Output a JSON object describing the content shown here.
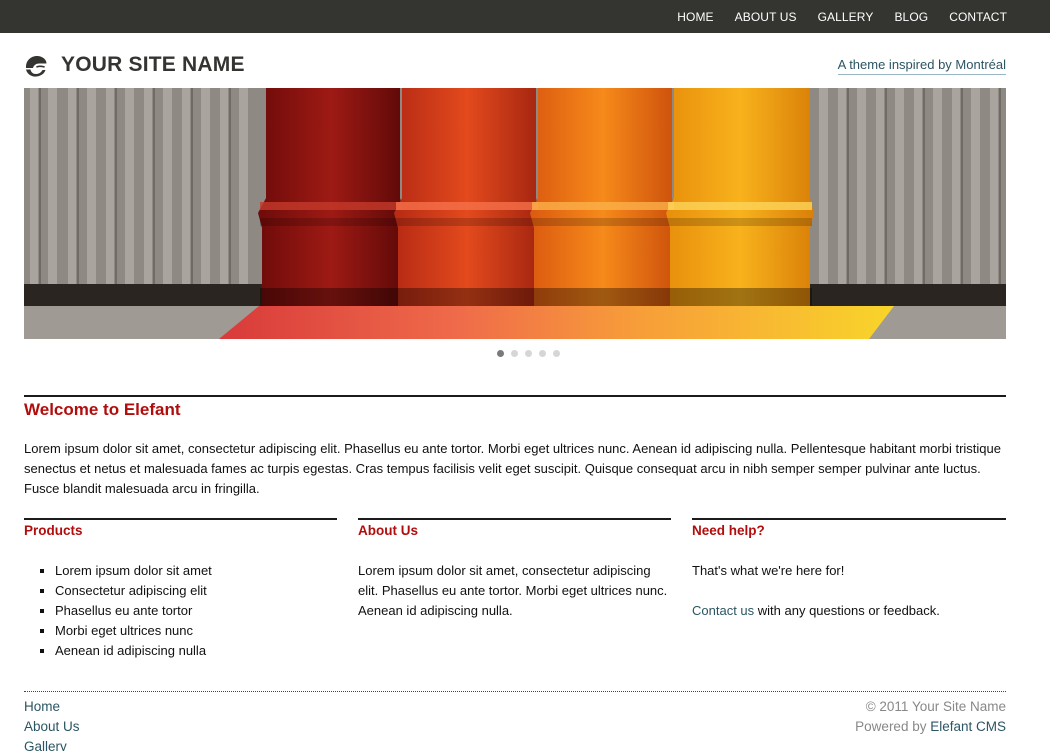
{
  "nav": {
    "items": [
      "HOME",
      "ABOUT US",
      "GALLERY",
      "BLOG",
      "CONTACT"
    ]
  },
  "header": {
    "site_name": "YOUR SITE NAME",
    "logo_icon": "elephant-logo-icon",
    "tagline": "A theme inspired by Montréal"
  },
  "slideshow": {
    "slide_count": 5,
    "active_index": 0
  },
  "welcome": {
    "title": "Welcome to Elefant",
    "body": "Lorem ipsum dolor sit amet, consectetur adipiscing elit. Phasellus eu ante tortor. Morbi eget ultrices nunc. Aenean id adipiscing nulla. Pellentesque habitant morbi tristique senectus et netus et malesuada fames ac turpis egestas. Cras tempus facilisis velit eget suscipit. Quisque consequat arcu in nibh semper semper pulvinar ante luctus. Fusce blandit malesuada arcu in fringilla."
  },
  "products": {
    "title": "Products",
    "items": [
      "Lorem ipsum dolor sit amet",
      "Consectetur adipiscing elit",
      "Phasellus eu ante tortor",
      "Morbi eget ultrices nunc",
      "Aenean id adipiscing nulla"
    ]
  },
  "about": {
    "title": "About Us",
    "text": "Lorem ipsum dolor sit amet, consectetur adipiscing elit. Phasellus eu ante tortor. Morbi eget ultrices nunc. Aenean id adipiscing nulla."
  },
  "help": {
    "title": "Need help?",
    "line1": "That's what we're here for!",
    "contact_link": "Contact us",
    "contact_suffix": " with any questions or feedback."
  },
  "footer": {
    "links": [
      "Home",
      "About Us",
      "Gallery"
    ],
    "copyright": "© 2011 Your Site Name",
    "powered_prefix": "Powered by ",
    "powered_link": "Elefant CMS"
  },
  "colors": {
    "topbar": "#343431",
    "heading_red": "#b20d0d",
    "link_blue": "#2b5563"
  }
}
